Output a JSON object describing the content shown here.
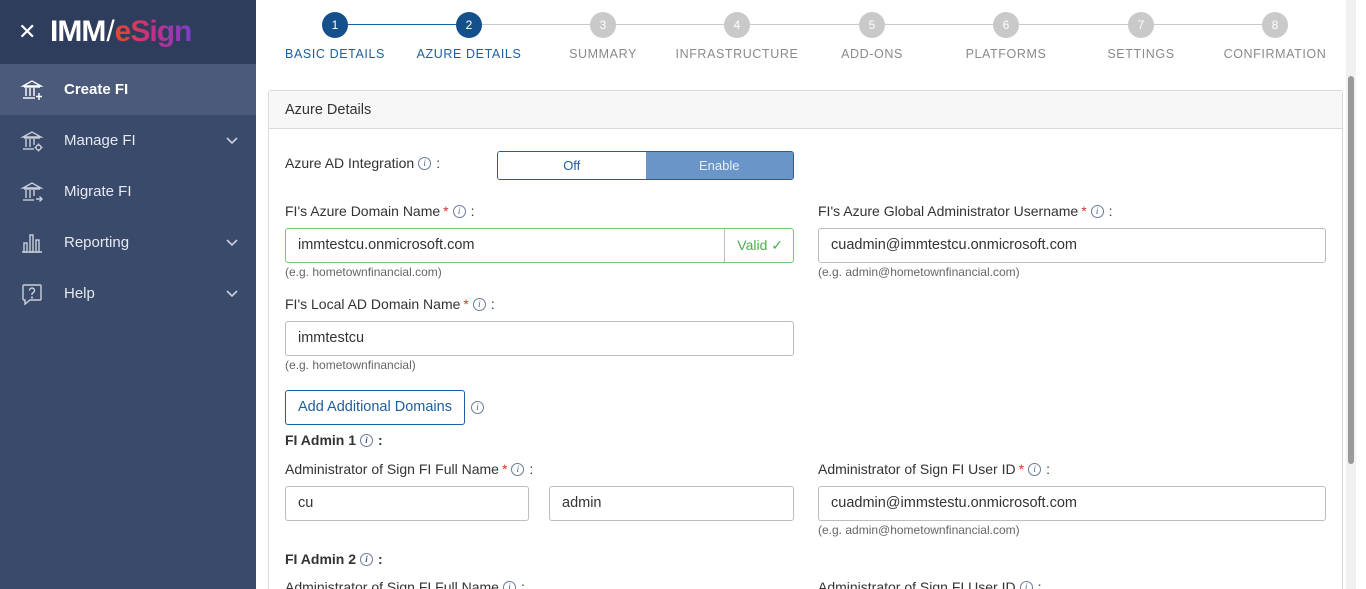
{
  "brand": {
    "close_icon": "close-icon",
    "logo_imm": "IMM",
    "logo_esign": "eSign"
  },
  "sidebar": {
    "items": [
      {
        "label": "Create FI",
        "icon": "bank-add-icon"
      },
      {
        "label": "Manage FI",
        "icon": "bank-settings-icon"
      },
      {
        "label": "Migrate FI",
        "icon": "bank-migrate-icon"
      },
      {
        "label": "Reporting",
        "icon": "bar-chart-icon"
      },
      {
        "label": "Help",
        "icon": "help-icon"
      }
    ]
  },
  "stepper": {
    "steps": [
      {
        "num": "1",
        "label": "BASIC DETAILS"
      },
      {
        "num": "2",
        "label": "AZURE DETAILS"
      },
      {
        "num": "3",
        "label": "SUMMARY"
      },
      {
        "num": "4",
        "label": "INFRASTRUCTURE"
      },
      {
        "num": "5",
        "label": "ADD-ONS"
      },
      {
        "num": "6",
        "label": "PLATFORMS"
      },
      {
        "num": "7",
        "label": "SETTINGS"
      },
      {
        "num": "8",
        "label": "CONFIRMATION"
      }
    ],
    "current_step": 2
  },
  "panel": {
    "title": "Azure Details",
    "ad_integration": {
      "label": "Azure AD Integration",
      "colon": ":",
      "off": "Off",
      "enable": "Enable"
    },
    "domain": {
      "label": "FI's Azure Domain Name",
      "value": "immtestcu.onmicrosoft.com",
      "valid": "Valid ✓",
      "hint": "(e.g. hometownfinancial.com)"
    },
    "global_admin": {
      "label": "FI's Azure Global Administrator Username",
      "value": "cuadmin@immtestcu.onmicrosoft.com",
      "hint": "(e.g. admin@hometownfinancial.com)"
    },
    "local_domain": {
      "label": "FI's Local AD Domain Name",
      "value": "immtestcu",
      "hint": "(e.g. hometownfinancial)"
    },
    "add_domains": "Add Additional Domains",
    "admin1": {
      "title": "FI Admin 1",
      "full_name_label": "Administrator of Sign FI Full Name",
      "first": "cu",
      "last": "admin",
      "user_id_label": "Administrator of Sign FI User ID",
      "user_id": "cuadmin@immstestu.onmicrosoft.com",
      "hint": "(e.g. admin@hometownfinancial.com)"
    },
    "admin2": {
      "title": "FI Admin 2",
      "full_name_label": "Administrator of Sign FI Full Name",
      "user_id_label": "Administrator of Sign FI User ID"
    },
    "required_mark": "*",
    "colon": ":",
    "info_glyph": "i"
  }
}
